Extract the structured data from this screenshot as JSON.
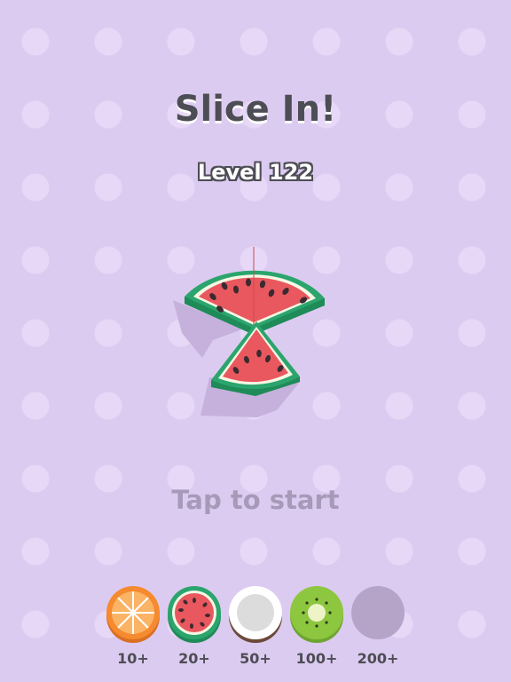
{
  "game": {
    "title": "Slice In!",
    "level_text": "Level 122",
    "prompt": "Tap to start"
  },
  "current_fruit": "watermelon",
  "milestones": [
    {
      "fruit": "orange",
      "label": "10+",
      "unlocked": true
    },
    {
      "fruit": "watermelon",
      "label": "20+",
      "unlocked": true
    },
    {
      "fruit": "coconut",
      "label": "50+",
      "unlocked": true
    },
    {
      "fruit": "kiwi",
      "label": "100+",
      "unlocked": true
    },
    {
      "fruit": "locked",
      "label": "200+",
      "unlocked": false
    }
  ],
  "colors": {
    "background": "#dccbf0",
    "title_text": "#4d4d55",
    "prompt_text": "#a799b8",
    "watermelon_flesh": "#e8585e",
    "watermelon_rind": "#2ba56d",
    "orange": "#f58a2f",
    "kiwi": "#8dc63f",
    "locked": "#b5a4c8"
  }
}
